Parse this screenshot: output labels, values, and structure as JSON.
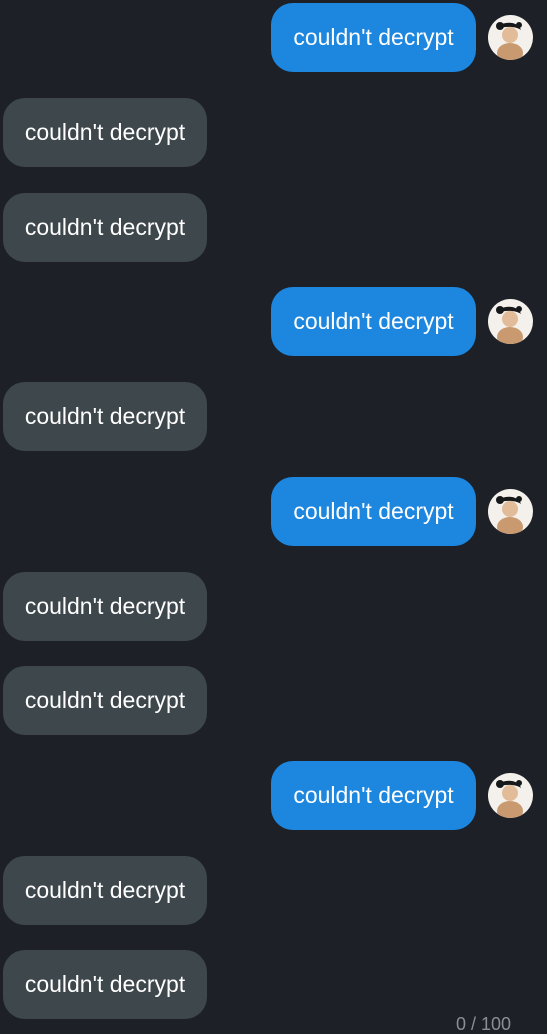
{
  "messages": [
    {
      "side": "out",
      "text": "couldn't decrypt"
    },
    {
      "side": "in",
      "text": "couldn't decrypt"
    },
    {
      "side": "in",
      "text": "couldn't decrypt"
    },
    {
      "side": "out",
      "text": "couldn't decrypt"
    },
    {
      "side": "in",
      "text": "couldn't decrypt"
    },
    {
      "side": "out",
      "text": "couldn't decrypt"
    },
    {
      "side": "in",
      "text": "couldn't decrypt"
    },
    {
      "side": "in",
      "text": "couldn't decrypt"
    },
    {
      "side": "out",
      "text": "couldn't decrypt"
    },
    {
      "side": "in",
      "text": "couldn't decrypt"
    },
    {
      "side": "in",
      "text": "couldn't decrypt"
    }
  ],
  "footer": {
    "counter_text": "0 / 100"
  },
  "colors": {
    "background": "#1d2127",
    "incoming_bubble": "#3e474c",
    "outgoing_bubble": "#1d87e0",
    "text": "#ffffff"
  },
  "icons": {
    "sender_avatar": "user-avatar-icon"
  }
}
